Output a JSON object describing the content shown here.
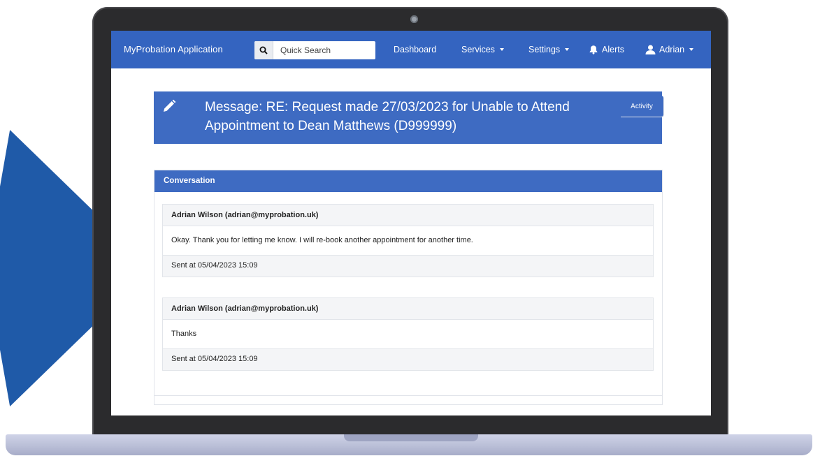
{
  "app": {
    "brand": "MyProbation Application",
    "search_placeholder": "Quick Search"
  },
  "nav": {
    "dashboard": "Dashboard",
    "services": "Services",
    "settings": "Settings",
    "alerts": "Alerts",
    "user": "Adrian"
  },
  "page": {
    "title": "Message: RE: Request made 27/03/2023 for Unable to Attend Appointment to Dean Matthews (D999999)",
    "activity_tab": "Activity"
  },
  "conversation": {
    "header": "Conversation",
    "messages": [
      {
        "sender": "Adrian Wilson (adrian@myprobation.uk)",
        "body": "Okay. Thank you for letting me know. I will re-book another appointment for another time.",
        "sent": "Sent at 05/04/2023 15:09"
      },
      {
        "sender": "Adrian Wilson (adrian@myprobation.uk)",
        "body": "Thanks",
        "sent": "Sent at 05/04/2023 15:09"
      }
    ]
  },
  "colors": {
    "navbar": "#3464c0",
    "accent": "#3e6bc2",
    "arrow": "#1f5aa8",
    "bezel": "#2b2b2d"
  },
  "icons": [
    "search-icon",
    "bell-icon",
    "user-icon",
    "pencil-icon",
    "chevron-down-icon"
  ]
}
